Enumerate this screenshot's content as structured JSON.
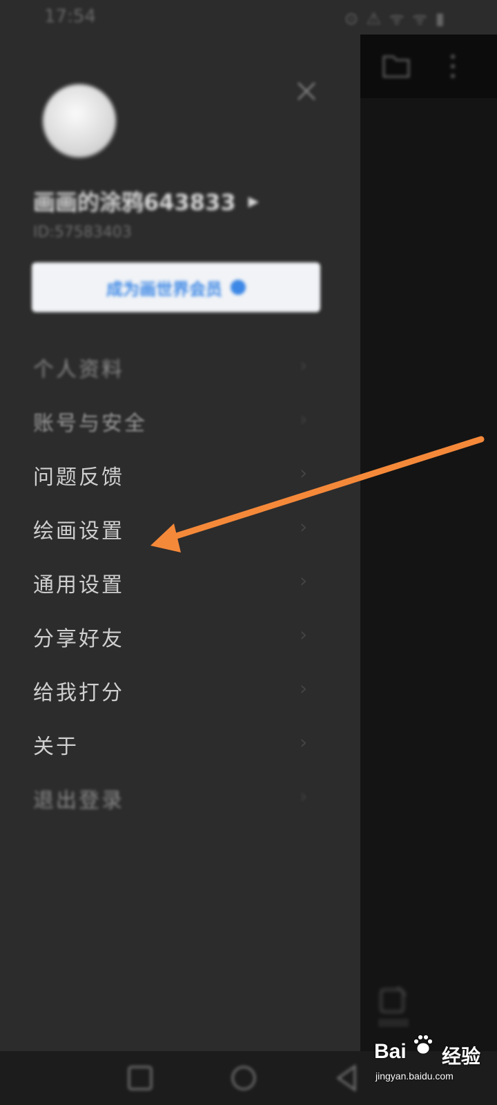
{
  "status_bar": {
    "time": "17:54",
    "icons": "⊙ ⚠ ᯤ ᯤ ▮"
  },
  "profile": {
    "username": "画画的涂鸦643833",
    "user_id": "ID:57583403",
    "vip_button_label": "成为画世界会员"
  },
  "menu": {
    "items": [
      {
        "label": "个人资料",
        "chevron": "›"
      },
      {
        "label": "账号与安全",
        "chevron": "›"
      },
      {
        "label": "问题反馈",
        "chevron": "›"
      },
      {
        "label": "绘画设置",
        "chevron": "›"
      },
      {
        "label": "通用设置",
        "chevron": "›"
      },
      {
        "label": "分享好友",
        "chevron": "›"
      },
      {
        "label": "给我打分",
        "chevron": "›"
      },
      {
        "label": "关于",
        "chevron": "›"
      },
      {
        "label": "退出登录",
        "chevron": "›"
      }
    ]
  },
  "annotation": {
    "arrow_color": "#f5893a",
    "target": "绘画设置"
  },
  "watermark": {
    "brand": "Bai",
    "brand_suffix": "经验",
    "url": "jingyan.baidu.com"
  },
  "colors": {
    "drawer_bg": "#2c2c2c",
    "accent_blue": "#3d88e6"
  }
}
